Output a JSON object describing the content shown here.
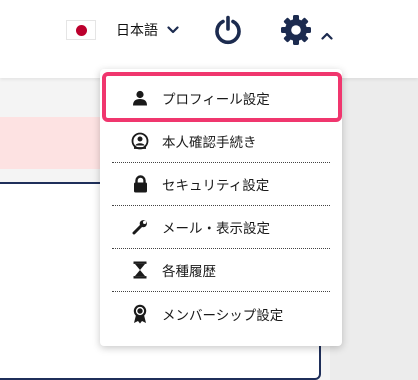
{
  "header": {
    "language_label": "日本語",
    "icons": {
      "flag": "japan-flag-icon",
      "language_chevron": "chevron-down-icon",
      "power": "power-icon",
      "settings": "gear-icon",
      "settings_chevron": "chevron-up-icon"
    }
  },
  "menu": {
    "items": [
      {
        "label": "プロフィール設定",
        "icon": "user-icon"
      },
      {
        "label": "本人確認手続き",
        "icon": "id-verification-icon"
      },
      {
        "label": "セキュリティ設定",
        "icon": "lock-icon"
      },
      {
        "label": "メール・表示設定",
        "icon": "wrench-icon"
      },
      {
        "label": "各種履歴",
        "icon": "hourglass-icon"
      },
      {
        "label": "メンバーシップ設定",
        "icon": "award-icon"
      }
    ],
    "selected_index": 0
  },
  "colors": {
    "highlight": "#f0366e",
    "flag_red": "#bc002d",
    "alert_background": "#fde2e2",
    "card_border": "#1f2f5a"
  }
}
